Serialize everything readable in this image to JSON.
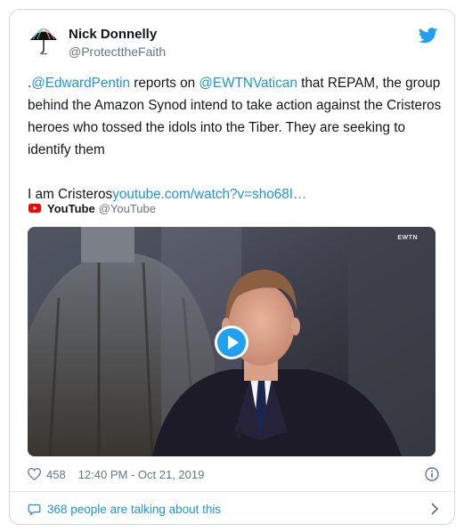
{
  "author": {
    "name": "Nick Donnelly",
    "handle": "@ProtecttheFaith",
    "avatar_icon": "umbrella-icon"
  },
  "tweet": {
    "prefix": ".",
    "mention1": "@EdwardPentin",
    "text1": " reports on ",
    "mention2": "@EWTNVatican",
    "text2": " that REPAM, the group behind the Amazon Synod intend to take action against the Cristeros heroes who tossed the idols into the Tiber. They are seeking to identify them",
    "text3": "I am Cristeros",
    "link": "youtube.com/watch?v=sho68I…"
  },
  "youtube": {
    "name": "YouTube",
    "handle": "@YouTube"
  },
  "media": {
    "watermark": "EWTN",
    "play_icon": "play-icon"
  },
  "footer": {
    "likes": "458",
    "timestamp": "12:40 PM - Oct 21, 2019",
    "talking": "368 people are talking about this"
  },
  "colors": {
    "link": "#1b95e0",
    "twitter_blue": "#1da1f2",
    "youtube_red": "#ff0000",
    "muted": "#657786",
    "border": "#cfd9de"
  }
}
